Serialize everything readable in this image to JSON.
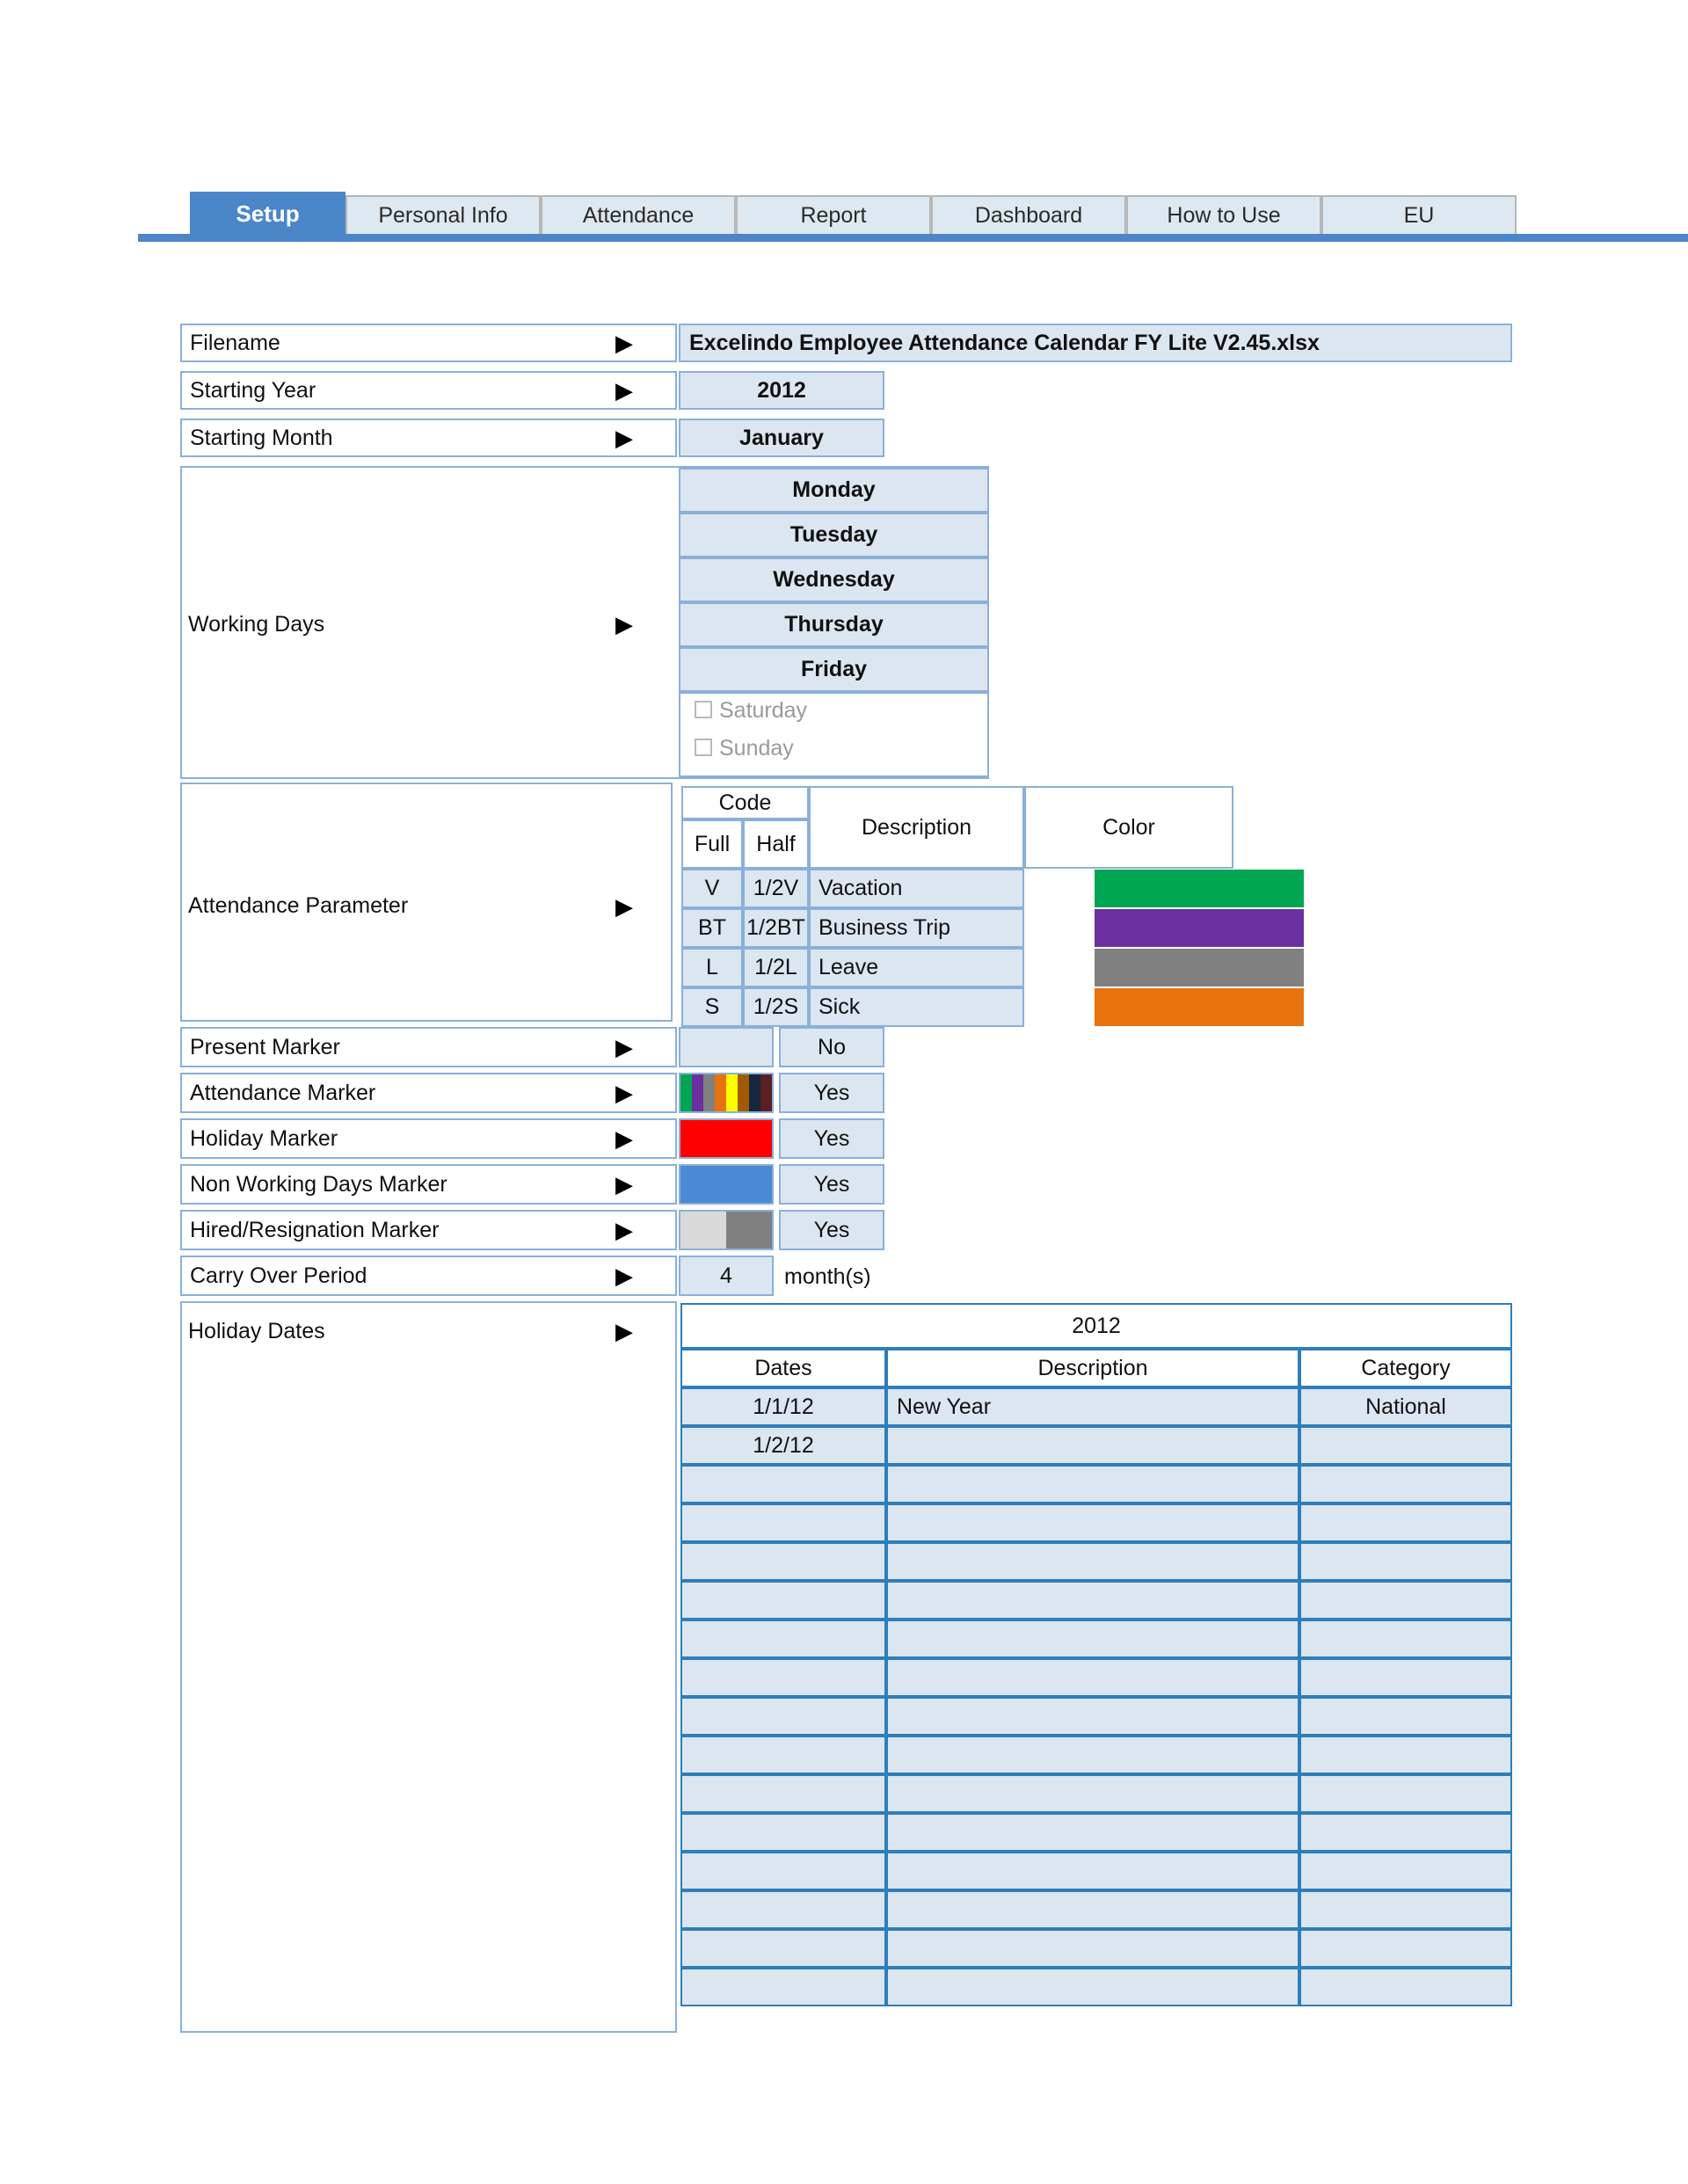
{
  "tabs": [
    {
      "label": "Setup",
      "active": true
    },
    {
      "label": "Personal Info",
      "active": false
    },
    {
      "label": "Attendance",
      "active": false
    },
    {
      "label": "Report",
      "active": false
    },
    {
      "label": "Dashboard",
      "active": false
    },
    {
      "label": "How to Use",
      "active": false
    },
    {
      "label": "EU",
      "active": false
    }
  ],
  "rows": {
    "filename": {
      "label": "Filename",
      "value": "Excelindo Employee Attendance Calendar FY Lite V2.45.xlsx"
    },
    "starting_year": {
      "label": "Starting Year",
      "value": "2012"
    },
    "starting_month": {
      "label": "Starting Month",
      "value": "January"
    },
    "working_days": {
      "label": "Working Days",
      "enabled": [
        "Monday",
        "Tuesday",
        "Wednesday",
        "Thursday",
        "Friday"
      ],
      "disabled": [
        "Saturday",
        "Sunday"
      ]
    },
    "attendance_parameter": {
      "label": "Attendance Parameter",
      "headers": {
        "code": "Code",
        "full": "Full",
        "half": "Half",
        "description": "Description",
        "color": "Color"
      },
      "items": [
        {
          "full": "V",
          "half": "1/2V",
          "description": "Vacation",
          "color": "#00a651"
        },
        {
          "full": "BT",
          "half": "1/2BT",
          "description": "Business Trip",
          "color": "#6b2fa0"
        },
        {
          "full": "L",
          "half": "1/2L",
          "description": "Leave",
          "color": "#808080"
        },
        {
          "full": "S",
          "half": "1/2S",
          "description": "Sick",
          "color": "#e8720c"
        }
      ]
    },
    "present_marker": {
      "label": "Present Marker",
      "value": "No",
      "colors": []
    },
    "attendance_marker": {
      "label": "Attendance Marker",
      "value": "Yes",
      "colors": [
        "#00a651",
        "#6b2fa0",
        "#808080",
        "#e8720c",
        "#ffff00",
        "#a05a00",
        "#16263f",
        "#5a2020"
      ]
    },
    "holiday_marker": {
      "label": "Holiday Marker",
      "value": "Yes",
      "colors": [
        "#ff0000"
      ]
    },
    "non_working_marker": {
      "label": "Non Working Days Marker",
      "value": "Yes",
      "colors": [
        "#4a8ad4"
      ]
    },
    "hired_resign_marker": {
      "label": "Hired/Resignation Marker",
      "value": "Yes",
      "colors": [
        "#d9d9d9",
        "#808080"
      ]
    },
    "carry_over_period": {
      "label": "Carry Over Period",
      "value": "4",
      "unit": "month(s)"
    },
    "holiday_dates": {
      "label": "Holiday Dates",
      "year": "2012",
      "headers": [
        "Dates",
        "Description",
        "Category"
      ],
      "entries": [
        {
          "date": "1/1/12",
          "description": "New Year",
          "category": "National"
        },
        {
          "date": "1/2/12",
          "description": "",
          "category": ""
        },
        {
          "date": "",
          "description": "",
          "category": ""
        },
        {
          "date": "",
          "description": "",
          "category": ""
        },
        {
          "date": "",
          "description": "",
          "category": ""
        },
        {
          "date": "",
          "description": "",
          "category": ""
        },
        {
          "date": "",
          "description": "",
          "category": ""
        },
        {
          "date": "",
          "description": "",
          "category": ""
        },
        {
          "date": "",
          "description": "",
          "category": ""
        },
        {
          "date": "",
          "description": "",
          "category": ""
        },
        {
          "date": "",
          "description": "",
          "category": ""
        },
        {
          "date": "",
          "description": "",
          "category": ""
        },
        {
          "date": "",
          "description": "",
          "category": ""
        },
        {
          "date": "",
          "description": "",
          "category": ""
        },
        {
          "date": "",
          "description": "",
          "category": ""
        },
        {
          "date": "",
          "description": "",
          "category": ""
        }
      ]
    }
  },
  "icons": {
    "arrow": "▶"
  }
}
